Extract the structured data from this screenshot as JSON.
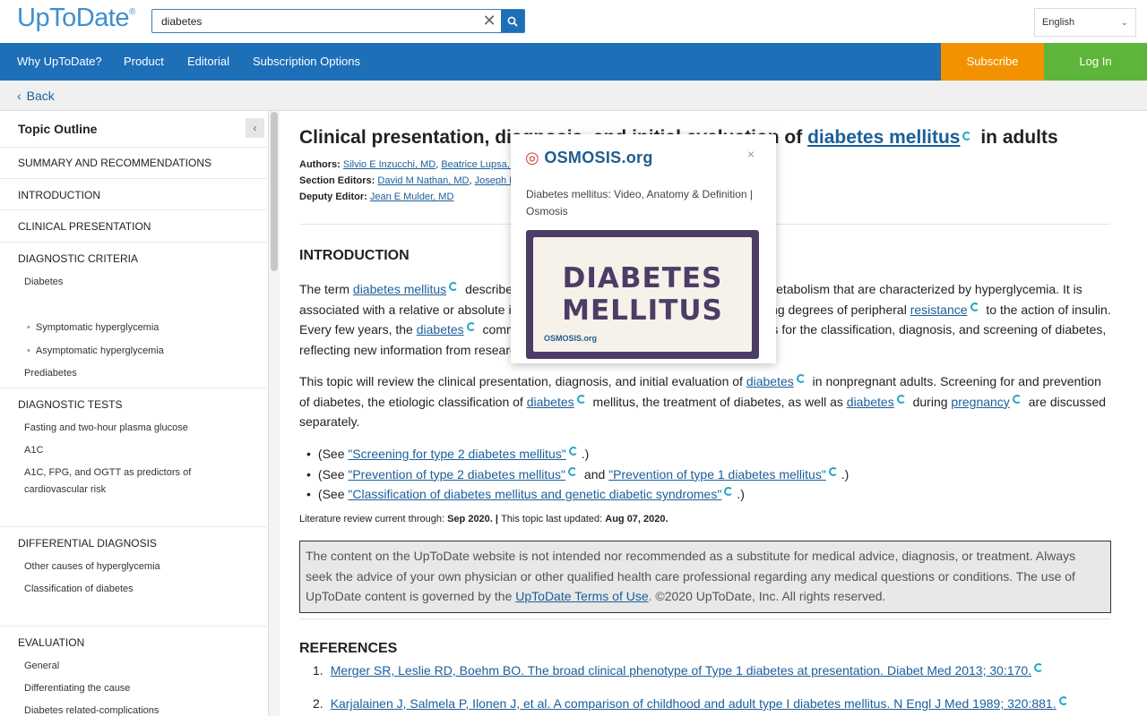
{
  "header": {
    "logo": "UpToDate",
    "logo_mark": "®",
    "search_value": "diabetes",
    "language": "English"
  },
  "nav": {
    "items": [
      "Why UpToDate?",
      "Product",
      "Editorial",
      "Subscription Options"
    ],
    "subscribe": "Subscribe",
    "login": "Log In"
  },
  "back": "Back",
  "sidebar": {
    "title": "Topic Outline",
    "sections": {
      "summary": "SUMMARY AND RECOMMENDATIONS",
      "intro": "INTRODUCTION",
      "clinical": "CLINICAL PRESENTATION",
      "diag_criteria": "DIAGNOSTIC CRITERIA",
      "diabetes": "Diabetes",
      "symptomatic": "Symptomatic hyperglycemia",
      "asymptomatic": "Asymptomatic hyperglycemia",
      "prediabetes": "Prediabetes",
      "diag_tests": "DIAGNOSTIC TESTS",
      "fasting": "Fasting and two-hour plasma glucose",
      "a1c": "A1C",
      "a1c_fpg_1": "A1C, FPG, and OGTT as predictors of",
      "a1c_fpg_2": "cardiovascular risk",
      "differential": "DIFFERENTIAL DIAGNOSIS",
      "other_causes": "Other causes of hyperglycemia",
      "classification": "Classification of diabetes",
      "evaluation": "EVALUATION",
      "general": "General",
      "differentiating": "Differentiating the cause",
      "complications": "Diabetes related-complications"
    }
  },
  "article": {
    "title_pre": "Clinical presentation, diagnosis, and initial evaluation of ",
    "title_link": "diabetes mellitus",
    "title_post": " in adults",
    "authors_label": "Authors:",
    "authors": [
      "Silvio E Inzucchi, MD",
      "Beatrice Lupsa, MD"
    ],
    "editors_label": "Section Editors:",
    "editors": [
      "David M Nathan, MD",
      "Joseph I Wolfsdorf, MD, BCh"
    ],
    "deputy_label": "Deputy Editor:",
    "deputy": "Jean E Mulder, MD",
    "intro_heading": "INTRODUCTION",
    "p1": {
      "a": "The term ",
      "l1": "diabetes mellitus",
      "b": " describes several diseases of abnormal carbohydrate metabolism that are characterized by hyperglycemia. It is associated with a relative or absolute impairment in insulin secretion, along with varying degrees of peripheral ",
      "l2": "resistance",
      "c": " to the action of insulin. Every few years, the ",
      "l3": "diabetes",
      "d": " community reevaluates the current recommendations for the classification, diagnosis, and screening of diabetes, reflecting new information from research and clinical practice."
    },
    "p2": {
      "a": "This topic will review the clinical presentation, diagnosis, and initial evaluation of ",
      "l1": "diabetes",
      "b": " in nonpregnant adults. Screening for and prevention of diabetes, the etiologic classification of ",
      "l2": "diabetes",
      "c": " mellitus, the treatment of diabetes, as well as ",
      "l3": "diabetes",
      "d": " during ",
      "l4": "pregnancy",
      "e": " are discussed separately."
    },
    "bullets": {
      "see": "(See ",
      "b1": "\"Screening for type 2 diabetes mellitus\"",
      "b2a": "\"Prevention of type 2 diabetes mellitus\"",
      "and": " and ",
      "b2b": "\"Prevention of type 1 diabetes mellitus\"",
      "b3": "\"Classification of diabetes mellitus and genetic diabetic syndromes\"",
      "end": ".)"
    },
    "lit_label": "Literature review current through: ",
    "lit_date": "Sep 2020.",
    "sep": " | ",
    "updated_label": "This topic last updated: ",
    "updated_date": "Aug 07, 2020.",
    "disclaimer_a": "The content on the UpToDate website is not intended nor recommended as a substitute for medical advice, diagnosis, or treatment. Always seek the advice of your own physician or other qualified health care professional regarding any medical questions or conditions. The use of UpToDate content is governed by the ",
    "disclaimer_link": "UpToDate Terms of Use",
    "disclaimer_b": ". ©2020 UpToDate, Inc. All rights reserved.",
    "refs_heading": "REFERENCES",
    "refs": [
      {
        "num": "1.",
        "text": "Merger SR, Leslie RD, Boehm BO. The broad clinical phenotype of Type 1 diabetes at presentation. Diabet Med 2013; 30:170."
      },
      {
        "num": "2.",
        "text": "Karjalainen J, Salmela P, Ilonen J, et al. A comparison of childhood and adult type I diabetes mellitus. N Engl J Med 1989; 320:881."
      }
    ]
  },
  "popup": {
    "brand": "OSMOSIS.org",
    "close": "×",
    "description": "Diabetes mellitus: Video, Anatomy & Definition | Osmosis",
    "thumb_line1": "DIABETES",
    "thumb_line2": "MELLITUS",
    "thumb_brand": "OSMOSIS.org"
  },
  "colors": {
    "brand_blue": "#1d6fb8",
    "subscribe_orange": "#f39200",
    "login_green": "#5db63b",
    "link": "#1a5e9a"
  }
}
